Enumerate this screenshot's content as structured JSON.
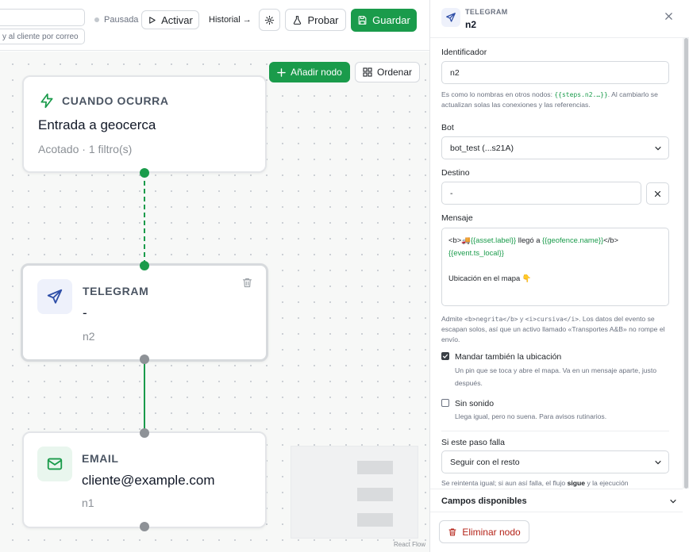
{
  "toolbar": {
    "description_fragment": "y al cliente por correo",
    "status_label": "Pausada",
    "activate_label": "Activar",
    "history_label": "Historial →",
    "test_label": "Probar",
    "save_label": "Guardar"
  },
  "canvas": {
    "add_node_label": "Añadir nodo",
    "order_label": "Ordenar",
    "attribution": "React Flow",
    "nodes": [
      {
        "kind": "CUANDO OCURRA",
        "title": "Entrada a geocerca",
        "subtitle": "Acotado · 1 filtro(s)",
        "icon": "lightning-icon"
      },
      {
        "kind": "TELEGRAM",
        "title": "-",
        "subtitle": "n2",
        "icon": "send-icon"
      },
      {
        "kind": "EMAIL",
        "title": "cliente@example.com",
        "subtitle": "n1",
        "icon": "mail-icon"
      }
    ]
  },
  "panel": {
    "kind": "TELEGRAM",
    "name": "n2",
    "identifier_label": "Identificador",
    "identifier_value": "n2",
    "identifier_help_1": "Es como lo nombras en otros nodos: ",
    "identifier_help_code": "{{steps.n2.…}}",
    "identifier_help_2": ". Al cambiarlo se actualizan solas las conexiones y las referencias.",
    "bot_label": "Bot",
    "bot_value": "bot_test (...s21A)",
    "destination_label": "Destino",
    "destination_value": "-",
    "message_label": "Mensaje",
    "message_line1_a": "<b>🚚",
    "message_line1_var1": "{{asset.label}}",
    "message_line1_b": " llegó a ",
    "message_line1_var2": "{{geofence.name}}",
    "message_line1_c": "</b>",
    "message_line2_var": "{{event.ts_local}}",
    "message_line3": "Ubicación en el mapa 👇",
    "message_help_1": "Admite ",
    "message_help_code1": "<b>negrita</b>",
    "message_help_2": " y ",
    "message_help_code2": "<i>cursiva</i>",
    "message_help_3": ". Los datos del evento se escapan solos, así que un activo llamado «Transportes A&B» no rompe el envío.",
    "send_location_label": "Mandar también la ubicación",
    "send_location_help": "Un pin que se toca y abre el mapa. Va en un mensaje aparte, justo después.",
    "send_location_checked": true,
    "silent_label": "Sin sonido",
    "silent_help": "Llega igual, pero no suena. Para avisos rutinarios.",
    "silent_checked": false,
    "failure_label": "Si este paso falla",
    "failure_value": "Seguir con el resto",
    "failure_help_1": "Se reintenta igual; si aun así falla, el flujo ",
    "failure_help_bold": "sigue",
    "failure_help_2": " y la ejecución",
    "fields_label": "Campos disponibles",
    "delete_label": "Eliminar nodo"
  },
  "colors": {
    "accent": "#1a9b4b",
    "danger": "#b42318",
    "telegram": "#2f4fa8"
  }
}
